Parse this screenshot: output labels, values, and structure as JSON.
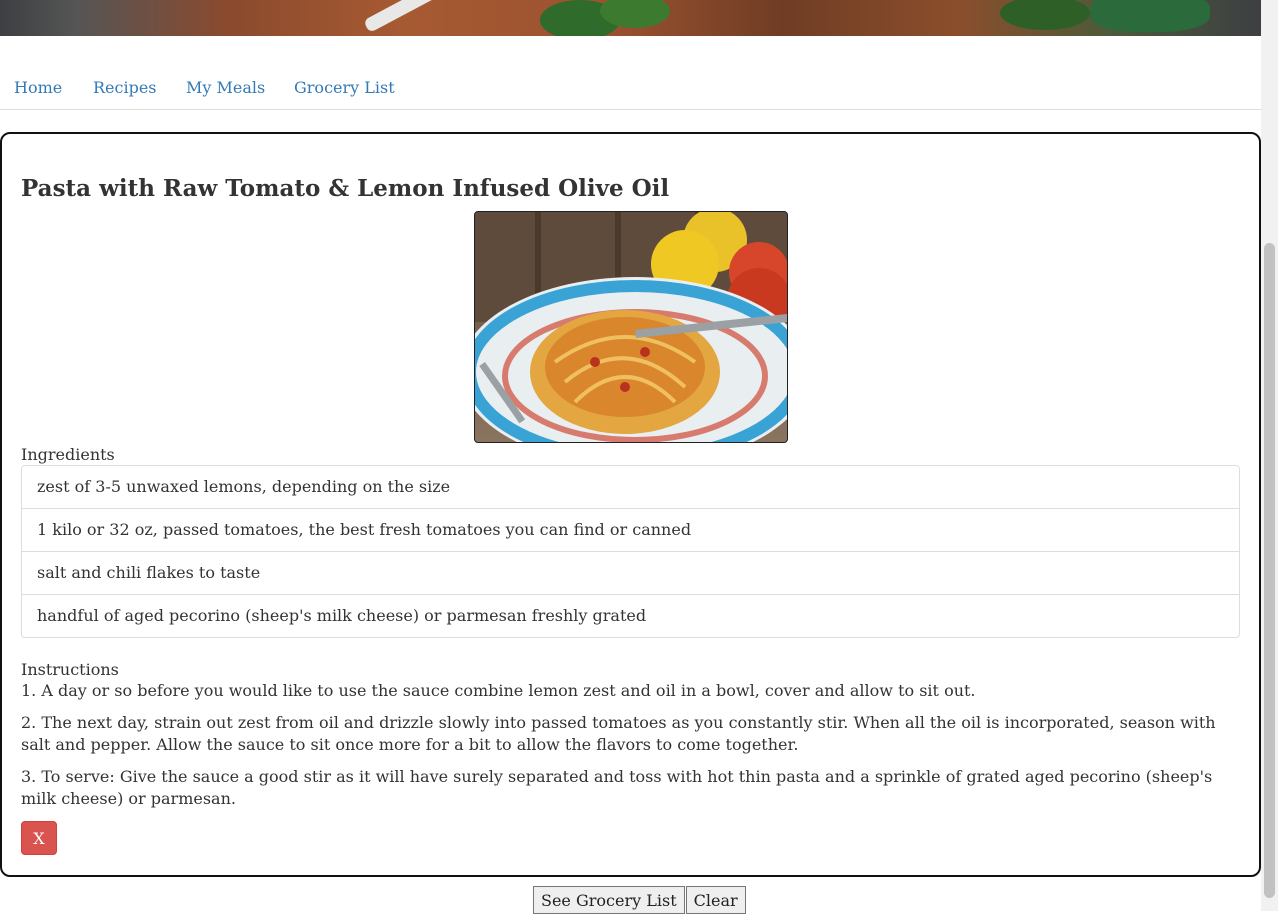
{
  "nav": {
    "home": "Home",
    "recipes": "Recipes",
    "my_meals": "My Meals",
    "grocery_list": "Grocery List"
  },
  "recipe": {
    "title": "Pasta with Raw Tomato & Lemon Infused Olive Oil",
    "ingredients_label": "Ingredients",
    "ingredients": [
      "zest of 3-5 unwaxed lemons, depending on the size",
      "1 kilo or 32 oz, passed tomatoes, the best fresh tomatoes you can find or canned",
      "salt and chili flakes to taste",
      "handful of aged pecorino (sheep's milk cheese) or parmesan freshly grated"
    ],
    "instructions_label": "Instructions",
    "instructions": [
      "1. A day or so before you would like to use the sauce combine lemon zest and oil in a bowl, cover and allow to sit out.",
      "2. The next day, strain out zest from oil and drizzle slowly into passed tomatoes as you constantly stir. When all the oil is incorporated, season with salt and pepper. Allow the sauce to sit once more for a bit to allow the flavors to come together.",
      "3. To serve: Give the sauce a good stir as it will have surely separated and toss with hot thin pasta and a sprinkle of grated aged pecorino (sheep's milk cheese) or parmesan."
    ],
    "delete_label": "X"
  },
  "actions": {
    "see_grocery_list": "See Grocery List",
    "clear": "Clear"
  },
  "colors": {
    "link": "#337ab7",
    "danger": "#d9534f"
  }
}
